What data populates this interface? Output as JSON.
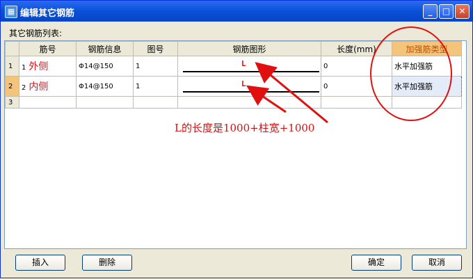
{
  "window": {
    "title": "编辑其它钢筋"
  },
  "list_label": "其它钢筋列表:",
  "table": {
    "headers": [
      "",
      "筋号",
      "钢筋信息",
      "图号",
      "钢筋图形",
      "长度(mm)",
      "加强筋类型"
    ],
    "rows": [
      {
        "rownum": "1",
        "bar_no": "1",
        "annotation": "外侧",
        "info": "Φ14@150",
        "fig": "1",
        "shape_letter": "L",
        "length": "0",
        "type": "水平加强筋"
      },
      {
        "rownum": "2",
        "bar_no": "2",
        "annotation": "内侧",
        "info": "Φ14@150",
        "fig": "1",
        "shape_letter": "L",
        "length": "0",
        "type": "水平加强筋"
      },
      {
        "rownum": "3",
        "bar_no": "",
        "annotation": "",
        "info": "",
        "fig": "",
        "shape_letter": "",
        "length": "",
        "type": ""
      }
    ]
  },
  "note": "L的长度是1000+柱宽+1000",
  "buttons": {
    "insert": "插入",
    "delete": "删除",
    "ok": "确定",
    "cancel": "取消"
  },
  "colors": {
    "title_bar": "#0a4fd8",
    "annotation_red": "#e0101a",
    "highlight_header": "#f4c47a"
  },
  "icons": {
    "minimize": "minimize-icon",
    "maximize": "maximize-icon",
    "close": "close-icon"
  }
}
